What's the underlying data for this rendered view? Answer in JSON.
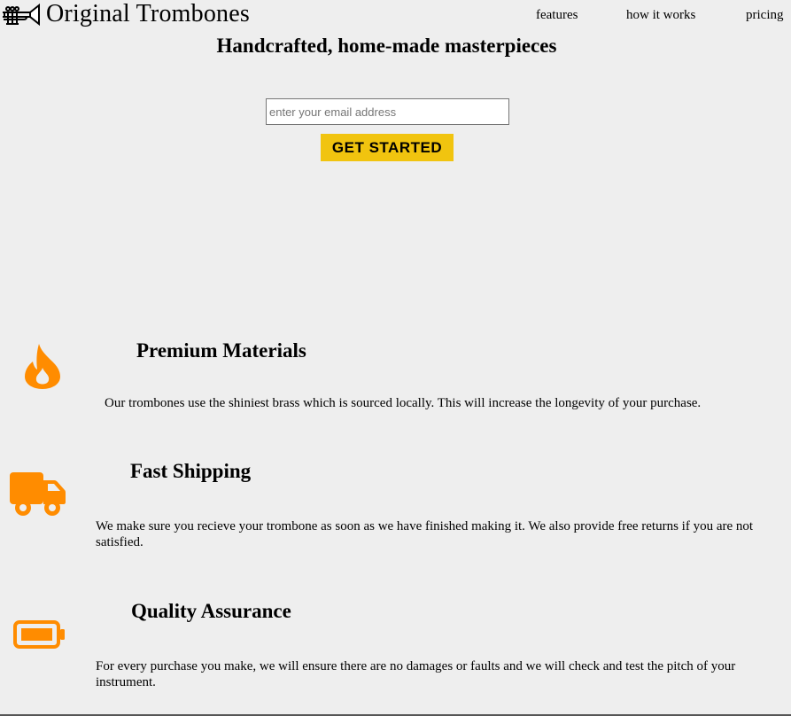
{
  "header": {
    "logo_text": "Original Trombones",
    "logo_icon": "trombone-icon",
    "nav": [
      {
        "label": "features"
      },
      {
        "label": "how it works"
      },
      {
        "label": "pricing"
      }
    ]
  },
  "hero": {
    "title": "Handcrafted, home-made masterpieces",
    "email_placeholder": "enter your email address",
    "email_value": "",
    "cta_label": "GET STARTED"
  },
  "features": [
    {
      "icon": "fire-icon",
      "title": "Premium Materials",
      "description": "Our trombones use the shiniest brass which is sourced locally. This will increase the longevity of your purchase."
    },
    {
      "icon": "truck-icon",
      "title": "Fast Shipping",
      "description": "We make sure you recieve your trombone as soon as we have finished making it. We also provide free returns if you are not satisfied."
    },
    {
      "icon": "battery-icon",
      "title": "Quality Assurance",
      "description": "For every purchase you make, we will ensure there are no damages or faults and we will check and test the pitch of your instrument."
    }
  ],
  "colors": {
    "background": "#eeeeee",
    "accent_button": "#f1c40f",
    "icon_orange": "#ff8c00"
  }
}
